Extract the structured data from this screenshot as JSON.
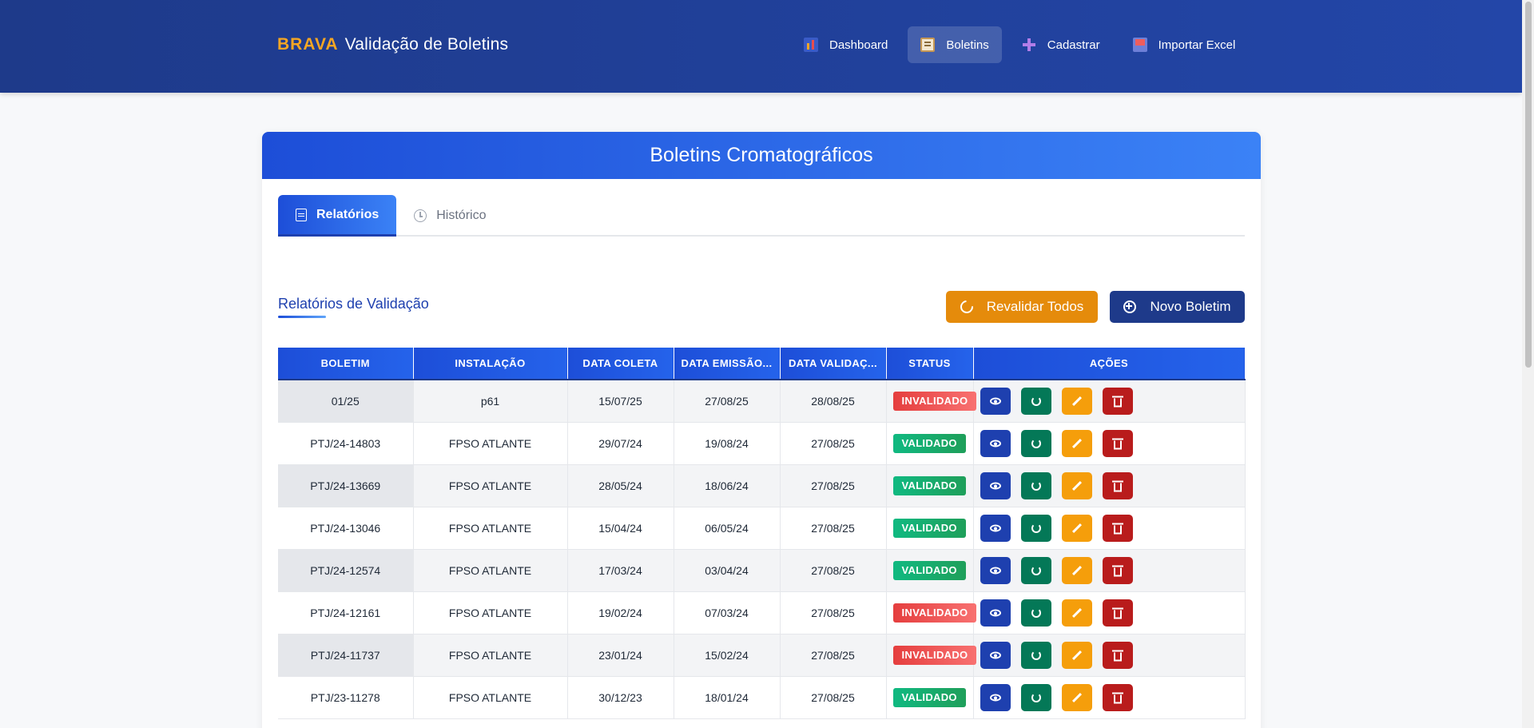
{
  "header": {
    "brand": "BRAVA",
    "title": "Validação de Boletins",
    "nav": [
      {
        "label": "Dashboard",
        "icon": "chart-icon"
      },
      {
        "label": "Boletins",
        "icon": "clipboard-icon",
        "active": true
      },
      {
        "label": "Cadastrar",
        "icon": "plus-icon"
      },
      {
        "label": "Importar Excel",
        "icon": "inbox-icon"
      }
    ]
  },
  "card": {
    "title": "Boletins Cromatográficos",
    "tabs": [
      {
        "label": "Relatórios",
        "active": true
      },
      {
        "label": "Histórico",
        "active": false
      }
    ],
    "section_title": "Relatórios de Validação",
    "buttons": {
      "revalidate_all": "Revalidar Todos",
      "new_bulletin": "Novo Boletim"
    }
  },
  "colors": {
    "header_bg": "#1e3a8a",
    "brand_accent": "#f6a623",
    "valid": "#10b981",
    "invalid": "#e53e3e",
    "view": "#1e40af",
    "revalidate": "#047857",
    "edit": "#f59e0b",
    "delete": "#b91c1c"
  },
  "table": {
    "columns": [
      "BOLETIM",
      "INSTALAÇÃO",
      "DATA COLETA",
      "DATA EMISSÃO...",
      "DATA VALIDAÇ...",
      "STATUS",
      "AÇÕES"
    ],
    "rows": [
      {
        "boletim": "01/25",
        "instalacao": "p61",
        "coleta": "15/07/25",
        "emissao": "27/08/25",
        "validacao": "28/08/25",
        "status": "INVALIDADO"
      },
      {
        "boletim": "PTJ/24-14803",
        "instalacao": "FPSO ATLANTE",
        "coleta": "29/07/24",
        "emissao": "19/08/24",
        "validacao": "27/08/25",
        "status": "VALIDADO"
      },
      {
        "boletim": "PTJ/24-13669",
        "instalacao": "FPSO ATLANTE",
        "coleta": "28/05/24",
        "emissao": "18/06/24",
        "validacao": "27/08/25",
        "status": "VALIDADO"
      },
      {
        "boletim": "PTJ/24-13046",
        "instalacao": "FPSO ATLANTE",
        "coleta": "15/04/24",
        "emissao": "06/05/24",
        "validacao": "27/08/25",
        "status": "VALIDADO"
      },
      {
        "boletim": "PTJ/24-12574",
        "instalacao": "FPSO ATLANTE",
        "coleta": "17/03/24",
        "emissao": "03/04/24",
        "validacao": "27/08/25",
        "status": "VALIDADO"
      },
      {
        "boletim": "PTJ/24-12161",
        "instalacao": "FPSO ATLANTE",
        "coleta": "19/02/24",
        "emissao": "07/03/24",
        "validacao": "27/08/25",
        "status": "INVALIDADO"
      },
      {
        "boletim": "PTJ/24-11737",
        "instalacao": "FPSO ATLANTE",
        "coleta": "23/01/24",
        "emissao": "15/02/24",
        "validacao": "27/08/25",
        "status": "INVALIDADO"
      },
      {
        "boletim": "PTJ/23-11278",
        "instalacao": "FPSO ATLANTE",
        "coleta": "30/12/23",
        "emissao": "18/01/24",
        "validacao": "27/08/25",
        "status": "VALIDADO"
      }
    ],
    "actions": [
      "view-icon",
      "revalidate-icon",
      "edit-icon",
      "delete-icon"
    ]
  }
}
